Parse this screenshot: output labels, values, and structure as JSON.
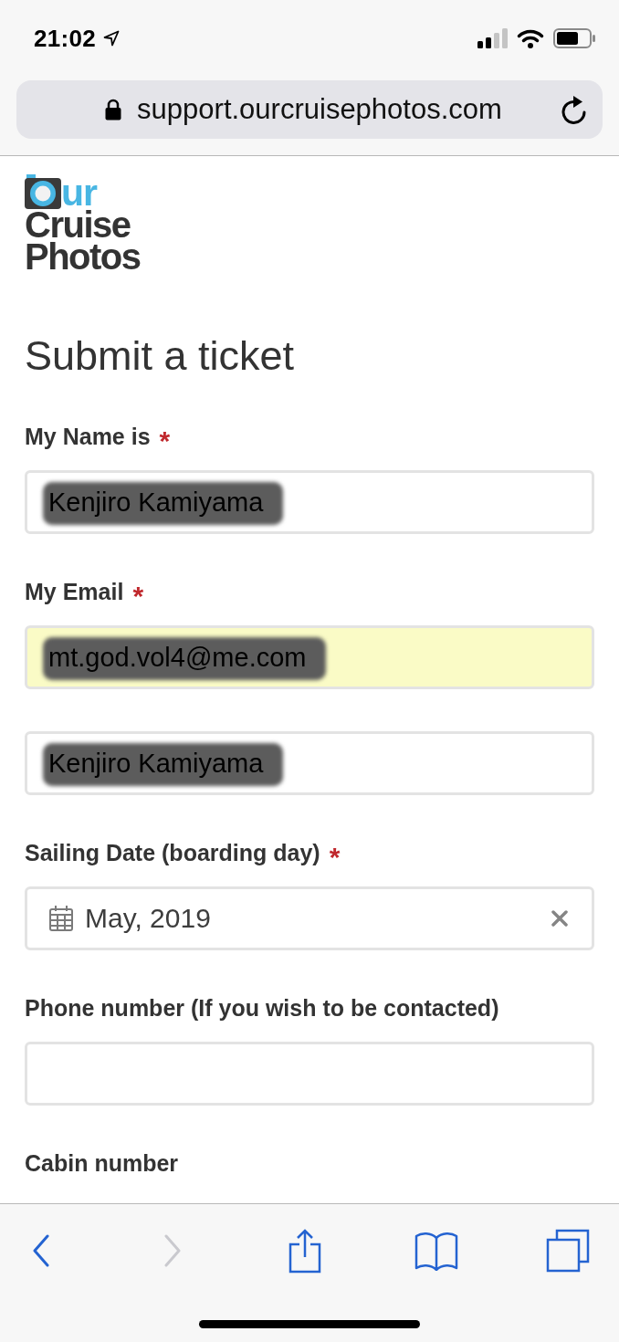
{
  "status_bar": {
    "time": "21:02",
    "location_active": true
  },
  "address_bar": {
    "url": "support.ourcruisephotos.com",
    "secure": true
  },
  "logo": {
    "first_line_rest": "ur",
    "lines": [
      "Cruise",
      "Photos"
    ]
  },
  "form": {
    "title": "Submit a ticket",
    "required_marker": "*",
    "fields": [
      {
        "kind": "text",
        "label": "My Name is",
        "required": true,
        "value": "Kenjiro Kamiyama",
        "autofilled": false,
        "redacted": true
      },
      {
        "kind": "text",
        "label": "My Email",
        "required": true,
        "value": "mt.god.vol4@me.com",
        "autofilled": true,
        "redacted": true
      },
      {
        "kind": "text",
        "value": "Kenjiro Kamiyama",
        "autofilled": false,
        "redacted": true
      },
      {
        "kind": "date",
        "label": "Sailing Date (boarding day)",
        "required": true,
        "value": "May, 2019",
        "autofilled": false,
        "redacted": false
      },
      {
        "kind": "text",
        "label": "Phone number (If you wish to be contacted)",
        "required": false,
        "autofilled": false,
        "redacted": false
      },
      {
        "kind": "label",
        "label": "Cabin number",
        "required": false
      }
    ]
  },
  "toolbar": {
    "buttons": [
      {
        "kind": "back",
        "disabled": false
      },
      {
        "kind": "forward",
        "disabled": true
      },
      {
        "kind": "share",
        "disabled": false
      },
      {
        "kind": "bookmarks",
        "disabled": false
      },
      {
        "kind": "tabs",
        "disabled": false
      }
    ]
  }
}
